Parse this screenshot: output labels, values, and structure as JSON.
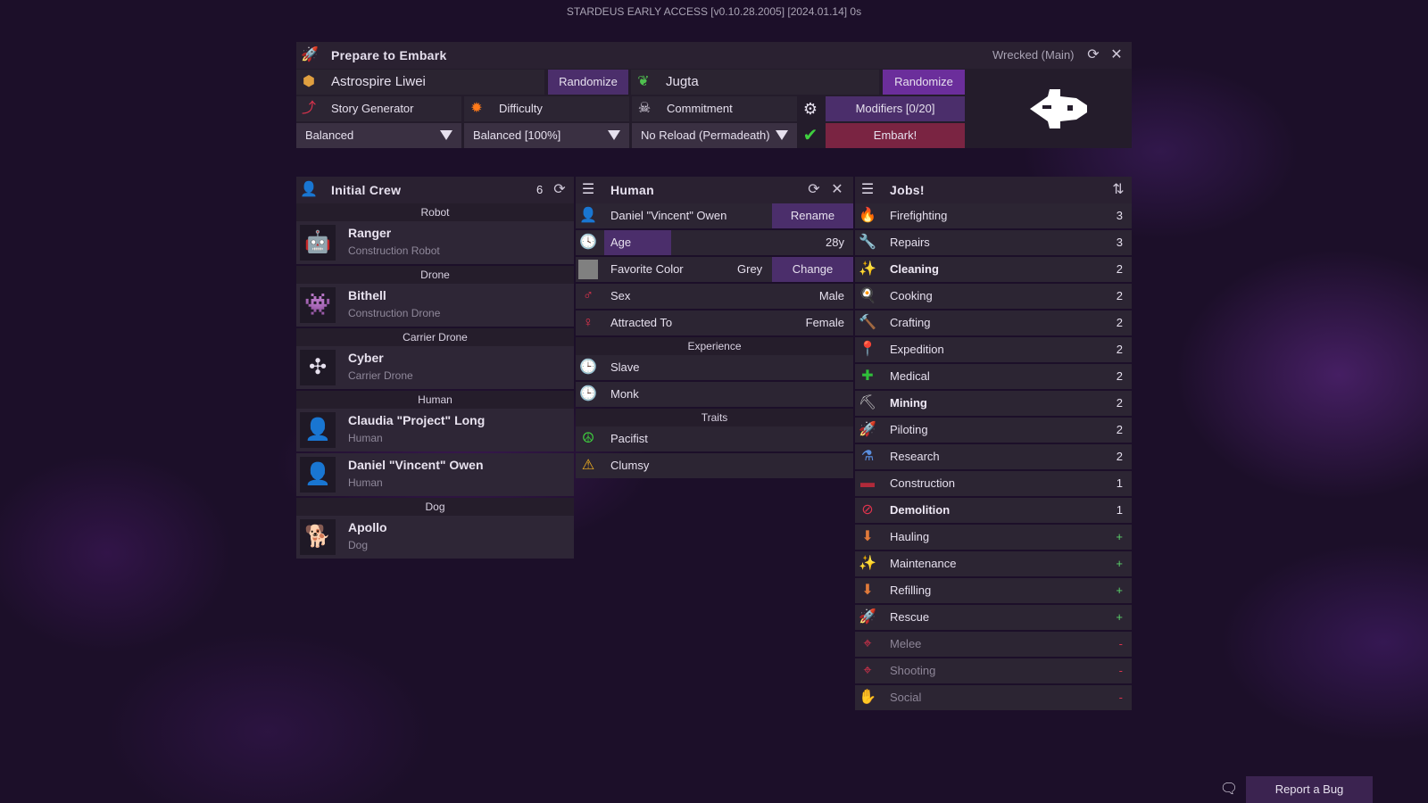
{
  "window_title": "STARDEUS EARLY ACCESS [v0.10.28.2005] [2024.01.14] 0s",
  "embark": {
    "title": "Prepare to Embark",
    "status": "Wrecked (Main)",
    "ship_name": "Astrospire Liwei",
    "randomize_label": "Randomize",
    "colony_name": "Jugta",
    "story_generator_label": "Story Generator",
    "difficulty_label": "Difficulty",
    "commitment_label": "Commitment",
    "modifiers_label": "Modifiers [0/20]",
    "story_value": "Balanced",
    "difficulty_value": "Balanced [100%]",
    "commitment_value": "No Reload (Permadeath)",
    "embark_label": "Embark!"
  },
  "crew": {
    "title": "Initial Crew",
    "count": "6",
    "groups": [
      {
        "label": "Robot",
        "members": [
          {
            "name": "Ranger",
            "sub": "Construction Robot",
            "icon": "🤖"
          }
        ]
      },
      {
        "label": "Drone",
        "members": [
          {
            "name": "Bithell",
            "sub": "Construction Drone",
            "icon": "👾"
          }
        ]
      },
      {
        "label": "Carrier Drone",
        "members": [
          {
            "name": "Cyber",
            "sub": "Carrier Drone",
            "icon": "✣"
          }
        ]
      },
      {
        "label": "Human",
        "members": [
          {
            "name": "Claudia \"Project\" Long",
            "sub": "Human",
            "icon": "👤"
          },
          {
            "name": "Daniel \"Vincent\" Owen",
            "sub": "Human",
            "icon": "👤"
          }
        ]
      },
      {
        "label": "Dog",
        "members": [
          {
            "name": "Apollo",
            "sub": "Dog",
            "icon": "🐕"
          }
        ]
      }
    ]
  },
  "human": {
    "title": "Human",
    "name": "Daniel \"Vincent\" Owen",
    "rename_label": "Rename",
    "age_label": "Age",
    "age_value": "28y",
    "age_fraction": 0.27,
    "color_label": "Favorite Color",
    "color_value": "Grey",
    "change_label": "Change",
    "sex_label": "Sex",
    "sex_value": "Male",
    "attracted_label": "Attracted To",
    "attracted_value": "Female",
    "experience_label": "Experience",
    "experience": [
      "Slave",
      "Monk"
    ],
    "traits_label": "Traits",
    "traits": [
      {
        "name": "Pacifist",
        "icon": "peace-icon"
      },
      {
        "name": "Clumsy",
        "icon": "warning-icon"
      }
    ]
  },
  "jobs": {
    "title": "Jobs!",
    "items": [
      {
        "name": "Firefighting",
        "value": "3",
        "icon": "🔥",
        "color": "#ff9a1f",
        "style": "normal"
      },
      {
        "name": "Repairs",
        "value": "3",
        "icon": "🔧",
        "color": "#cfcfcf",
        "style": "normal"
      },
      {
        "name": "Cleaning",
        "value": "2",
        "icon": "✨",
        "color": "#ffc24a",
        "style": "bold"
      },
      {
        "name": "Cooking",
        "value": "2",
        "icon": "🍳",
        "color": "#d0d0d0",
        "style": "normal"
      },
      {
        "name": "Crafting",
        "value": "2",
        "icon": "🔨",
        "color": "#d0d0d0",
        "style": "normal"
      },
      {
        "name": "Expedition",
        "value": "2",
        "icon": "📍",
        "color": "#e0334d",
        "style": "normal"
      },
      {
        "name": "Medical",
        "value": "2",
        "icon": "✚",
        "color": "#2fbf3a",
        "style": "normal"
      },
      {
        "name": "Mining",
        "value": "2",
        "icon": "⛏",
        "color": "#d0d0d0",
        "style": "bold"
      },
      {
        "name": "Piloting",
        "value": "2",
        "icon": "🚀",
        "color": "#e0334d",
        "style": "normal"
      },
      {
        "name": "Research",
        "value": "2",
        "icon": "⚗",
        "color": "#5a8fe0",
        "style": "normal"
      },
      {
        "name": "Construction",
        "value": "1",
        "icon": "▬",
        "color": "#b02a3a",
        "style": "normal"
      },
      {
        "name": "Demolition",
        "value": "1",
        "icon": "⊘",
        "color": "#e0334d",
        "style": "bold"
      },
      {
        "name": "Hauling",
        "value": "+",
        "icon": "⬇",
        "color": "#e07a3a",
        "style": "plus"
      },
      {
        "name": "Maintenance",
        "value": "+",
        "icon": "✨",
        "color": "#ffc24a",
        "style": "plus"
      },
      {
        "name": "Refilling",
        "value": "+",
        "icon": "⬇",
        "color": "#e07a3a",
        "style": "plus"
      },
      {
        "name": "Rescue",
        "value": "+",
        "icon": "🚀",
        "color": "#e0334d",
        "style": "plus"
      },
      {
        "name": "Melee",
        "value": "-",
        "icon": "⌖",
        "color": "#e0334d",
        "style": "minus"
      },
      {
        "name": "Shooting",
        "value": "-",
        "icon": "⌖",
        "color": "#e0334d",
        "style": "minus"
      },
      {
        "name": "Social",
        "value": "-",
        "icon": "✋",
        "color": "#ffb32a",
        "style": "minus"
      }
    ]
  },
  "report_bug_label": "Report a Bug"
}
